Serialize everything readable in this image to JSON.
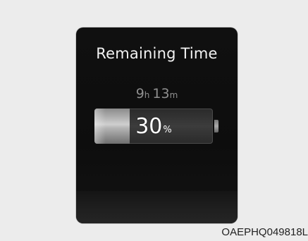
{
  "display": {
    "title": "Remaining Time",
    "hours": "9",
    "hours_unit": "h",
    "minutes": "13",
    "minutes_unit": "m",
    "battery_percent_text": "30",
    "percent_symbol": "%",
    "battery_level": 0.3
  },
  "image_code": "OAEPHQ049818L",
  "colors": {
    "page_background": "#ececec",
    "panel_background": "#101010",
    "title_text": "#f2f2f2",
    "time_text": "#8f8f8f"
  }
}
